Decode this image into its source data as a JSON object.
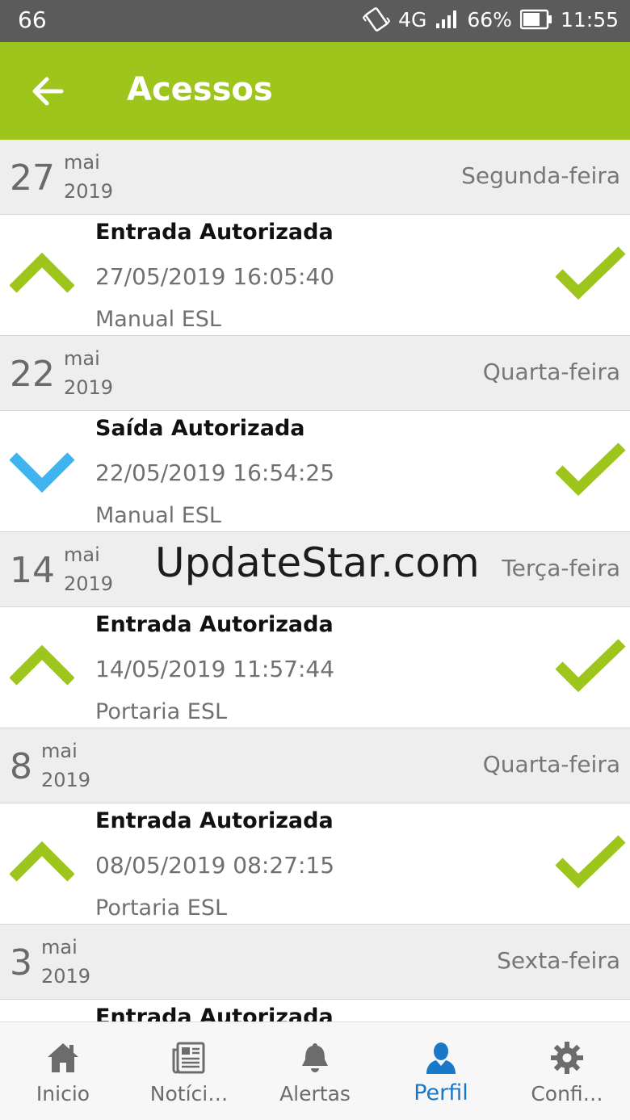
{
  "status_bar": {
    "notification": "66",
    "network": "4G",
    "battery": "66%",
    "time": "11:55"
  },
  "app_bar": {
    "title": "Acessos",
    "back_icon": "arrow-left-icon"
  },
  "colors": {
    "accent": "#9ec51c",
    "entry_arrow": "#9ec51c",
    "exit_arrow": "#40b4ee",
    "active_nav": "#1a78c8"
  },
  "days": [
    {
      "day": "27",
      "month": "mai",
      "year": "2019",
      "weekday": "Segunda-feira",
      "entry": {
        "type": "entrada",
        "title": "Entrada Autorizada",
        "datetime": "27/05/2019 16:05:40",
        "source": "Manual ESL"
      }
    },
    {
      "day": "22",
      "month": "mai",
      "year": "2019",
      "weekday": "Quarta-feira",
      "entry": {
        "type": "saida",
        "title": "Saída Autorizada",
        "datetime": "22/05/2019 16:54:25",
        "source": "Manual ESL"
      }
    },
    {
      "day": "14",
      "month": "mai",
      "year": "2019",
      "weekday": "Terça-feira",
      "entry": {
        "type": "entrada",
        "title": "Entrada Autorizada",
        "datetime": "14/05/2019 11:57:44",
        "source": "Portaria ESL"
      }
    },
    {
      "day": "8",
      "month": "mai",
      "year": "2019",
      "weekday": "Quarta-feira",
      "entry": {
        "type": "entrada",
        "title": "Entrada Autorizada",
        "datetime": "08/05/2019 08:27:15",
        "source": "Portaria ESL"
      }
    },
    {
      "day": "3",
      "month": "mai",
      "year": "2019",
      "weekday": "Sexta-feira",
      "entry": {
        "type": "entrada",
        "title": "Entrada Autorizada",
        "datetime": "",
        "source": ""
      }
    }
  ],
  "watermark": "UpdateStar.com",
  "bottom_nav": [
    {
      "label": "Inicio",
      "icon": "home-icon",
      "active": false
    },
    {
      "label": "Notíci…",
      "icon": "newspaper-icon",
      "active": false
    },
    {
      "label": "Alertas",
      "icon": "bell-icon",
      "active": false
    },
    {
      "label": "Perfil",
      "icon": "person-icon",
      "active": true
    },
    {
      "label": "Confi…",
      "icon": "gear-icon",
      "active": false
    }
  ]
}
